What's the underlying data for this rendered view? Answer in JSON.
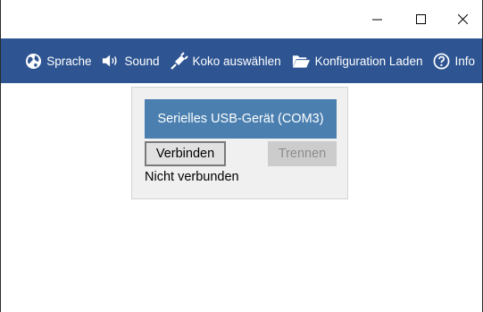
{
  "titlebar": {
    "minimize_icon": "minimize-icon",
    "maximize_icon": "maximize-icon",
    "close_icon": "close-icon"
  },
  "toolbar": {
    "items": [
      {
        "label": "Sprache",
        "icon": "globe-icon"
      },
      {
        "label": "Sound",
        "icon": "speaker-icon"
      },
      {
        "label": "Koko auswählen",
        "icon": "plug-icon"
      },
      {
        "label": "Konfiguration Laden",
        "icon": "folder-open-icon"
      },
      {
        "label": "Info",
        "icon": "help-circle-icon"
      }
    ],
    "background": "#2e5592"
  },
  "device_panel": {
    "device_name": "Serielles USB-Gerät (COM3)",
    "connect_label": "Verbinden",
    "disconnect_label": "Trennen",
    "status": "Nicht verbunden",
    "device_color": "#4a7fb0"
  }
}
